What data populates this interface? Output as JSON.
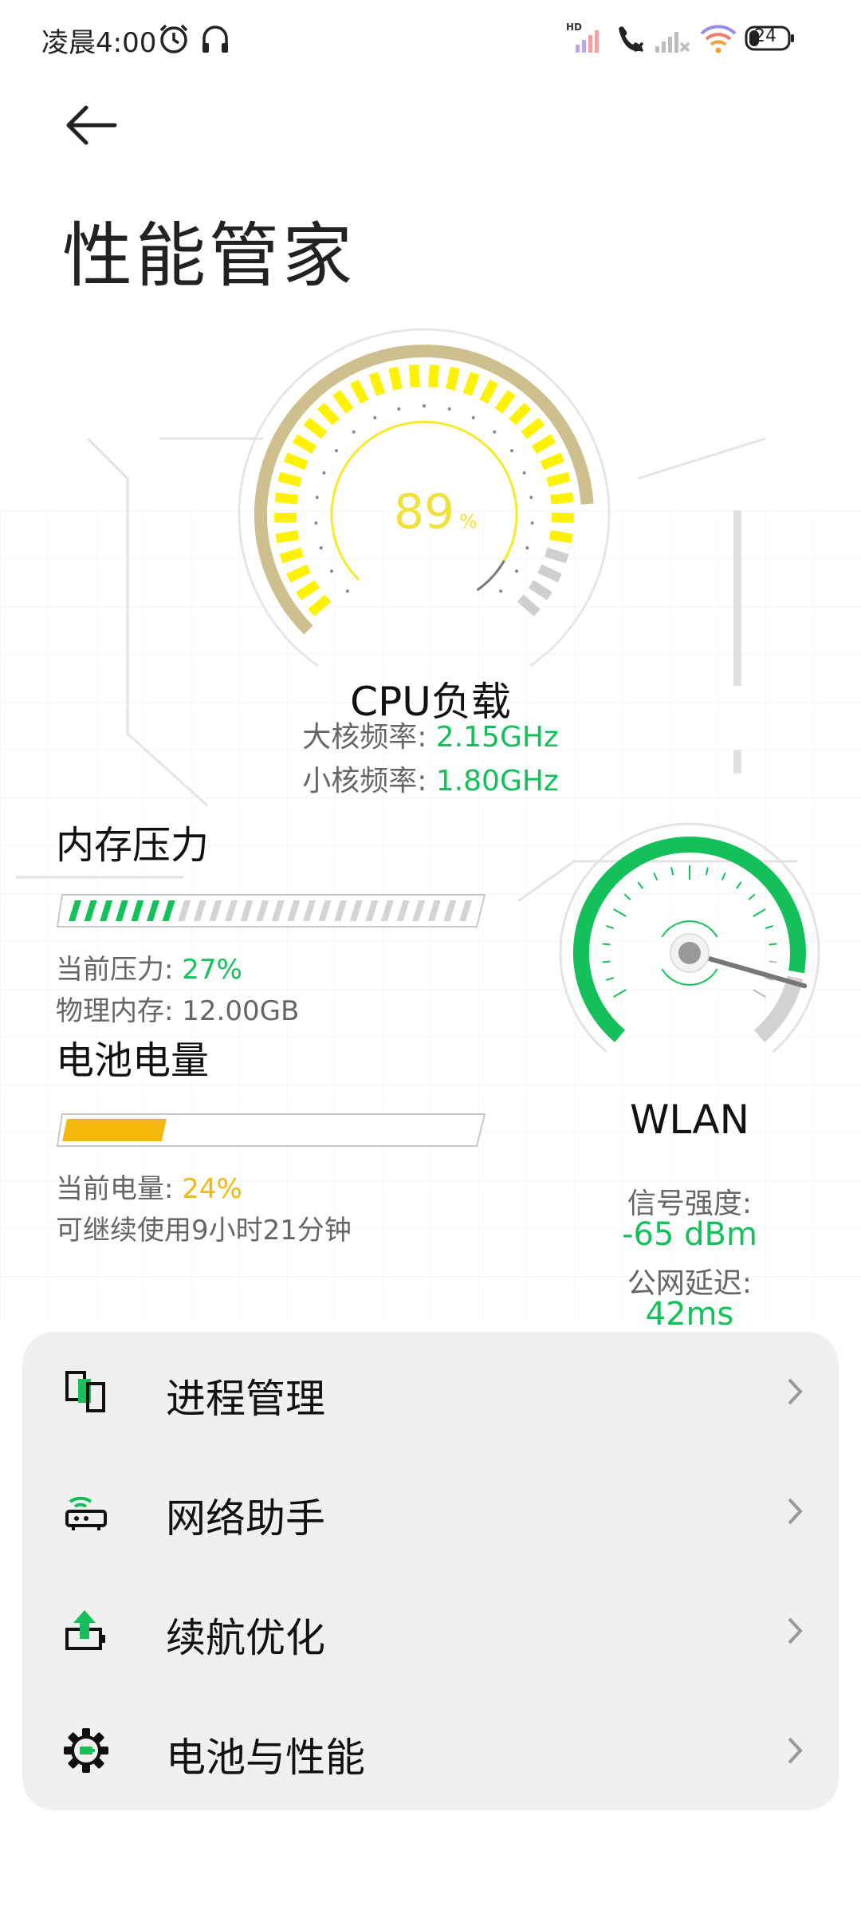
{
  "status_bar": {
    "time": "凌晨4:00",
    "battery_level": "24",
    "icons": [
      "alarm-icon",
      "headset-icon",
      "hd-signal-icon",
      "call-blocked-icon",
      "no-signal-icon",
      "wifi-icon",
      "battery-icon"
    ]
  },
  "header": {
    "title": "性能管家"
  },
  "cpu": {
    "load_percent": 89,
    "value": "89",
    "unit": "%",
    "title": "CPU负载",
    "big_core_label": "大核频率:",
    "big_core_value": "2.15GHz",
    "little_core_label": "小核频率:",
    "little_core_value": "1.80GHz"
  },
  "memory": {
    "title": "内存压力",
    "pressure_fraction": 0.27,
    "pressure_label": "当前压力:",
    "pressure_value": "27%",
    "physical_label": "物理内存:",
    "physical_value": "12.00GB"
  },
  "battery": {
    "title": "电池电量",
    "level_fraction": 0.24,
    "level_label": "当前电量:",
    "level_value": "24%",
    "remaining_text": "可继续使用9小时21分钟"
  },
  "wlan": {
    "title": "WLAN",
    "signal_label": "信号强度:",
    "signal_value": "-65 dBm",
    "latency_label": "公网延迟:",
    "latency_value": "42ms"
  },
  "menu": {
    "items": [
      {
        "label": "进程管理",
        "icon": "process-manager-icon"
      },
      {
        "label": "网络助手",
        "icon": "router-icon"
      },
      {
        "label": "续航优化",
        "icon": "battery-boost-icon"
      },
      {
        "label": "电池与性能",
        "icon": "gear-icon"
      }
    ]
  },
  "colors": {
    "accent_green": "#13c05a",
    "accent_yellow": "#fff200",
    "battery_orange": "#f5b80a",
    "gauge_tan": "#cdbf8e"
  }
}
